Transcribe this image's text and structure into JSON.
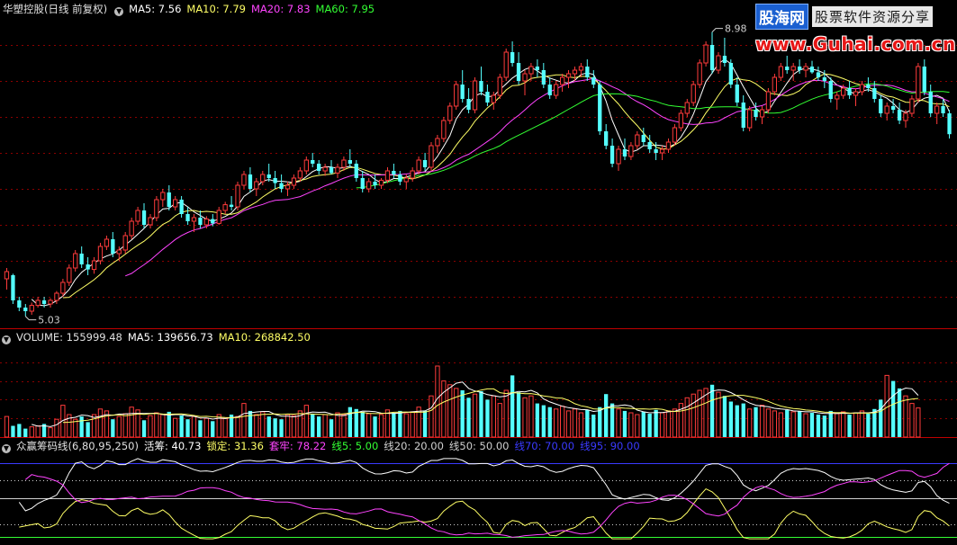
{
  "price_panel": {
    "title": "华塑控股(日线 前复权)",
    "ma5_label": "MA5: 7.56",
    "ma10_label": "MA10: 7.79",
    "ma20_label": "MA20: 7.83",
    "ma60_label": "MA60: 7.95",
    "high_label": "8.98",
    "low_label": "5.03"
  },
  "volume_panel": {
    "volume_label": "VOLUME: 155999.48",
    "ma5_label": "MA5: 139656.73",
    "ma10_label": "MA10: 268842.50"
  },
  "indicator_panel": {
    "name_label": "众赢筹码线(6,80,95,250)",
    "huochou_label": "活筹: 40.73",
    "suoding_label": "锁定: 31.36",
    "taolao_label": "套牢: 78.22",
    "x5_label": "线5: 5.00",
    "x20_label": "线20: 20.00",
    "x50_label": "线50: 50.00",
    "x70_label": "线70: 70.00",
    "x95_label": "线95: 90.00"
  },
  "logo": {
    "brand": "股海网",
    "slogan": "股票软件资源分享",
    "url": "www.Guhai.com.cn"
  },
  "colors": {
    "up": "#ff3b3b",
    "down": "#54ffff",
    "ma5": "#ffffff",
    "ma10": "#ffff66",
    "ma20": "#ff44ff",
    "ma60": "#33ff33",
    "grid": "#8b0000",
    "huochou": "#ffffff",
    "suoding": "#ffff66",
    "taolao": "#ff44ff",
    "x5": "#33ff33",
    "x95": "#3a3aff"
  },
  "chart_data": [
    {
      "type": "candlestick",
      "title": "华塑控股(日线 前复权)",
      "ylim": [
        4.9,
        9.2
      ],
      "annotations": [
        {
          "label": "8.98",
          "value": 8.98
        },
        {
          "label": "5.03",
          "value": 5.03
        }
      ],
      "candles": [
        [
          5.55,
          5.7,
          5.4,
          5.65
        ],
        [
          5.6,
          5.62,
          5.2,
          5.25
        ],
        [
          5.25,
          5.3,
          5.1,
          5.15
        ],
        [
          5.15,
          5.2,
          5.03,
          5.1
        ],
        [
          5.1,
          5.22,
          5.05,
          5.18
        ],
        [
          5.18,
          5.3,
          5.15,
          5.25
        ],
        [
          5.25,
          5.3,
          5.15,
          5.2
        ],
        [
          5.2,
          5.28,
          5.15,
          5.25
        ],
        [
          5.25,
          5.38,
          5.2,
          5.35
        ],
        [
          5.35,
          5.55,
          5.3,
          5.5
        ],
        [
          5.5,
          5.75,
          5.45,
          5.7
        ],
        [
          5.7,
          5.95,
          5.65,
          5.9
        ],
        [
          5.9,
          6.0,
          5.7,
          5.75
        ],
        [
          5.75,
          5.85,
          5.6,
          5.68
        ],
        [
          5.68,
          5.85,
          5.62,
          5.8
        ],
        [
          5.8,
          6.05,
          5.75,
          6.0
        ],
        [
          6.0,
          6.15,
          5.95,
          6.1
        ],
        [
          6.1,
          6.2,
          5.85,
          5.9
        ],
        [
          5.9,
          6.0,
          5.8,
          5.95
        ],
        [
          5.95,
          6.2,
          5.9,
          6.15
        ],
        [
          6.15,
          6.4,
          6.1,
          6.35
        ],
        [
          6.35,
          6.55,
          6.3,
          6.5
        ],
        [
          6.5,
          6.6,
          6.25,
          6.3
        ],
        [
          6.3,
          6.45,
          6.25,
          6.4
        ],
        [
          6.4,
          6.7,
          6.35,
          6.65
        ],
        [
          6.65,
          6.8,
          6.55,
          6.75
        ],
        [
          6.75,
          6.85,
          6.5,
          6.55
        ],
        [
          6.55,
          6.7,
          6.5,
          6.65
        ],
        [
          6.65,
          6.7,
          6.4,
          6.45
        ],
        [
          6.45,
          6.55,
          6.3,
          6.35
        ],
        [
          6.35,
          6.45,
          6.2,
          6.4
        ],
        [
          6.4,
          6.5,
          6.25,
          6.3
        ],
        [
          6.3,
          6.42,
          6.25,
          6.38
        ],
        [
          6.38,
          6.45,
          6.28,
          6.32
        ],
        [
          6.32,
          6.55,
          6.3,
          6.5
        ],
        [
          6.5,
          6.62,
          6.45,
          6.58
        ],
        [
          6.58,
          6.7,
          6.5,
          6.55
        ],
        [
          6.55,
          6.9,
          6.5,
          6.85
        ],
        [
          6.85,
          7.05,
          6.8,
          7.0
        ],
        [
          7.0,
          7.1,
          6.75,
          6.8
        ],
        [
          6.8,
          6.95,
          6.7,
          6.9
        ],
        [
          6.9,
          7.05,
          6.85,
          7.0
        ],
        [
          7.0,
          7.15,
          6.9,
          6.95
        ],
        [
          6.95,
          7.05,
          6.8,
          6.88
        ],
        [
          6.88,
          7.0,
          6.75,
          6.8
        ],
        [
          6.8,
          6.9,
          6.7,
          6.85
        ],
        [
          6.85,
          7.0,
          6.8,
          6.95
        ],
        [
          6.95,
          7.1,
          6.9,
          7.05
        ],
        [
          7.05,
          7.25,
          7.0,
          7.2
        ],
        [
          7.2,
          7.3,
          7.1,
          7.15
        ],
        [
          7.15,
          7.2,
          7.0,
          7.05
        ],
        [
          7.05,
          7.15,
          6.98,
          7.1
        ],
        [
          7.1,
          7.2,
          7.0,
          7.02
        ],
        [
          7.02,
          7.15,
          6.95,
          7.1
        ],
        [
          7.1,
          7.25,
          7.05,
          7.2
        ],
        [
          7.2,
          7.35,
          7.1,
          7.15
        ],
        [
          7.15,
          7.2,
          6.9,
          6.95
        ],
        [
          6.95,
          7.05,
          6.75,
          6.8
        ],
        [
          6.8,
          6.95,
          6.75,
          6.9
        ],
        [
          6.9,
          7.0,
          6.8,
          6.85
        ],
        [
          6.85,
          6.95,
          6.8,
          6.92
        ],
        [
          6.92,
          7.1,
          6.88,
          7.05
        ],
        [
          7.05,
          7.15,
          6.95,
          7.0
        ],
        [
          7.0,
          7.05,
          6.85,
          6.9
        ],
        [
          6.9,
          7.0,
          6.8,
          6.95
        ],
        [
          6.95,
          7.1,
          6.9,
          7.05
        ],
        [
          7.05,
          7.25,
          7.0,
          7.2
        ],
        [
          7.2,
          7.3,
          7.05,
          7.1
        ],
        [
          7.1,
          7.45,
          7.05,
          7.4
        ],
        [
          7.4,
          7.55,
          7.3,
          7.5
        ],
        [
          7.5,
          7.8,
          7.45,
          7.75
        ],
        [
          7.75,
          8.0,
          7.7,
          7.95
        ],
        [
          7.95,
          8.3,
          7.9,
          8.25
        ],
        [
          8.25,
          8.45,
          8.0,
          8.05
        ],
        [
          8.05,
          8.2,
          7.85,
          7.9
        ],
        [
          7.9,
          8.35,
          7.85,
          8.3
        ],
        [
          8.3,
          8.5,
          8.1,
          8.15
        ],
        [
          8.15,
          8.25,
          7.95,
          8.0
        ],
        [
          8.0,
          8.15,
          7.9,
          8.1
        ],
        [
          8.1,
          8.4,
          8.05,
          8.35
        ],
        [
          8.35,
          8.75,
          8.3,
          8.7
        ],
        [
          8.7,
          8.85,
          8.5,
          8.55
        ],
        [
          8.55,
          8.7,
          8.25,
          8.3
        ],
        [
          8.3,
          8.45,
          8.1,
          8.4
        ],
        [
          8.4,
          8.55,
          8.3,
          8.5
        ],
        [
          8.5,
          8.6,
          8.35,
          8.45
        ],
        [
          8.45,
          8.55,
          8.2,
          8.25
        ],
        [
          8.25,
          8.35,
          8.05,
          8.1
        ],
        [
          8.1,
          8.3,
          8.05,
          8.25
        ],
        [
          8.25,
          8.4,
          8.15,
          8.35
        ],
        [
          8.35,
          8.45,
          8.2,
          8.4
        ],
        [
          8.4,
          8.5,
          8.3,
          8.45
        ],
        [
          8.45,
          8.55,
          8.35,
          8.5
        ],
        [
          8.5,
          8.6,
          8.3,
          8.35
        ],
        [
          8.35,
          8.45,
          8.2,
          8.25
        ],
        [
          8.25,
          8.3,
          7.55,
          7.6
        ],
        [
          7.6,
          7.7,
          7.35,
          7.4
        ],
        [
          7.4,
          7.5,
          7.1,
          7.15
        ],
        [
          7.15,
          7.4,
          7.05,
          7.35
        ],
        [
          7.35,
          7.5,
          7.2,
          7.25
        ],
        [
          7.25,
          7.45,
          7.2,
          7.4
        ],
        [
          7.4,
          7.6,
          7.35,
          7.55
        ],
        [
          7.55,
          7.65,
          7.4,
          7.45
        ],
        [
          7.45,
          7.55,
          7.3,
          7.35
        ],
        [
          7.35,
          7.45,
          7.2,
          7.3
        ],
        [
          7.3,
          7.4,
          7.2,
          7.35
        ],
        [
          7.35,
          7.5,
          7.3,
          7.45
        ],
        [
          7.45,
          7.7,
          7.4,
          7.65
        ],
        [
          7.65,
          7.9,
          7.6,
          7.85
        ],
        [
          7.85,
          8.05,
          7.8,
          8.0
        ],
        [
          8.0,
          8.3,
          7.95,
          8.25
        ],
        [
          8.25,
          8.6,
          8.2,
          8.55
        ],
        [
          8.55,
          8.85,
          8.5,
          8.8
        ],
        [
          8.8,
          8.98,
          8.4,
          8.45
        ],
        [
          8.45,
          8.7,
          8.4,
          8.65
        ],
        [
          8.65,
          8.9,
          8.5,
          8.55
        ],
        [
          8.55,
          8.6,
          8.2,
          8.25
        ],
        [
          8.25,
          8.35,
          7.95,
          8.0
        ],
        [
          8.0,
          8.1,
          7.6,
          7.65
        ],
        [
          7.65,
          7.95,
          7.6,
          7.9
        ],
        [
          7.9,
          8.0,
          7.75,
          7.8
        ],
        [
          7.8,
          7.95,
          7.7,
          7.9
        ],
        [
          7.9,
          8.2,
          7.85,
          8.15
        ],
        [
          8.15,
          8.4,
          8.1,
          8.35
        ],
        [
          8.35,
          8.55,
          8.3,
          8.5
        ],
        [
          8.5,
          8.65,
          8.4,
          8.45
        ],
        [
          8.45,
          8.55,
          8.3,
          8.5
        ],
        [
          8.5,
          8.6,
          8.4,
          8.45
        ],
        [
          8.45,
          8.55,
          8.35,
          8.5
        ],
        [
          8.5,
          8.58,
          8.4,
          8.42
        ],
        [
          8.42,
          8.5,
          8.3,
          8.35
        ],
        [
          8.35,
          8.45,
          8.2,
          8.3
        ],
        [
          8.3,
          8.35,
          8.0,
          8.05
        ],
        [
          8.05,
          8.15,
          7.9,
          8.1
        ],
        [
          8.1,
          8.25,
          8.05,
          8.2
        ],
        [
          8.2,
          8.3,
          8.05,
          8.1
        ],
        [
          8.1,
          8.2,
          7.95,
          8.15
        ],
        [
          8.15,
          8.3,
          8.1,
          8.25
        ],
        [
          8.25,
          8.35,
          8.15,
          8.2
        ],
        [
          8.2,
          8.3,
          8.0,
          8.05
        ],
        [
          8.05,
          8.1,
          7.8,
          7.85
        ],
        [
          7.85,
          8.0,
          7.75,
          7.95
        ],
        [
          7.95,
          8.05,
          7.85,
          7.9
        ],
        [
          7.9,
          8.0,
          7.7,
          7.75
        ],
        [
          7.75,
          7.9,
          7.65,
          7.85
        ],
        [
          7.85,
          8.1,
          7.8,
          8.05
        ],
        [
          8.05,
          8.55,
          8.0,
          8.5
        ],
        [
          8.5,
          8.6,
          8.1,
          8.15
        ],
        [
          8.15,
          8.25,
          7.8,
          7.85
        ],
        [
          7.85,
          8.0,
          7.7,
          7.95
        ],
        [
          7.95,
          8.05,
          7.8,
          7.85
        ],
        [
          7.85,
          7.9,
          7.5,
          7.56
        ]
      ]
    },
    {
      "type": "bar",
      "title": "VOLUME",
      "ylim": [
        0,
        500000
      ],
      "values": [
        110,
        60,
        70,
        45,
        55,
        60,
        70,
        50,
        95,
        170,
        120,
        95,
        110,
        80,
        120,
        150,
        140,
        95,
        110,
        125,
        160,
        145,
        90,
        115,
        130,
        120,
        135,
        100,
        115,
        95,
        110,
        90,
        100,
        85,
        120,
        100,
        120,
        110,
        180,
        140,
        120,
        135,
        110,
        100,
        95,
        120,
        115,
        140,
        170,
        125,
        110,
        120,
        95,
        130,
        120,
        160,
        150,
        135,
        125,
        110,
        120,
        145,
        130,
        140,
        125,
        135,
        160,
        140,
        220,
        380,
        300,
        280,
        260,
        250,
        210,
        230,
        245,
        200,
        220,
        180,
        250,
        330,
        240,
        210,
        220,
        180,
        170,
        160,
        150,
        165,
        140,
        150,
        130,
        145,
        120,
        160,
        230,
        180,
        150,
        140,
        130,
        120,
        135,
        125,
        145,
        130,
        140,
        150,
        180,
        210,
        230,
        250,
        260,
        280,
        240,
        220,
        190,
        170,
        180,
        150,
        160,
        170,
        150,
        140,
        130,
        145,
        135,
        140,
        125,
        130,
        120,
        115,
        140,
        125,
        135,
        120,
        130,
        140,
        125,
        150,
        200,
        330,
        300,
        260,
        220,
        180,
        156
      ],
      "ma5": 139656.73,
      "ma10": 268842.5
    },
    {
      "type": "line",
      "title": "众赢筹码线(6,80,95,250)",
      "ylim": [
        0,
        100
      ],
      "reference_lines": [
        5,
        20,
        50,
        70,
        90
      ],
      "series": [
        {
          "name": "活筹",
          "last": 40.73
        },
        {
          "name": "锁定",
          "last": 31.36
        },
        {
          "name": "套牢",
          "last": 78.22
        }
      ]
    }
  ]
}
